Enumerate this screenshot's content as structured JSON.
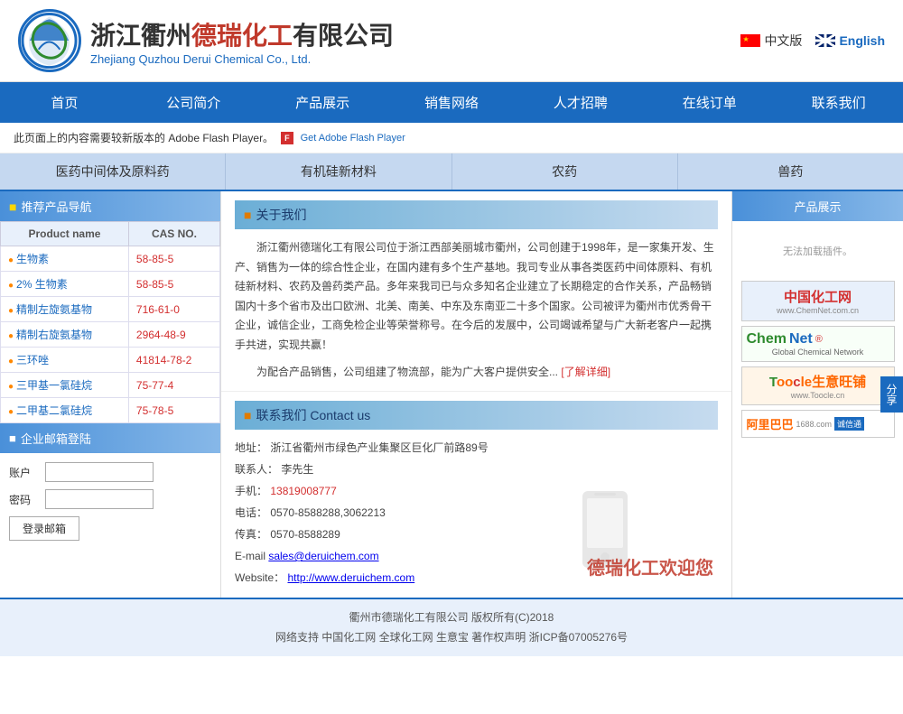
{
  "header": {
    "logo_cn_prefix": "浙江衢州",
    "logo_cn_brand": "德瑞化工",
    "logo_cn_suffix": "有限公司",
    "logo_en": "Zhejiang Quzhou Derui Chemical Co., Ltd.",
    "lang_cn": "中文版",
    "lang_en": "English"
  },
  "nav": {
    "items": [
      "首页",
      "公司简介",
      "产品展示",
      "销售网络",
      "人才招聘",
      "在线订单",
      "联系我们"
    ]
  },
  "flash_notice": "此页面上的内容需要较新版本的 Adobe Flash Player。",
  "flash_label": "Get Adobe Flash Player",
  "categories": [
    "医药中间体及原料药",
    "有机硅新材料",
    "农药",
    "兽药"
  ],
  "sidebar": {
    "rec_header": "推荐产品导航",
    "col_product": "Product name",
    "col_cas": "CAS NO.",
    "products": [
      {
        "name": "生物素",
        "cas": "58-85-5"
      },
      {
        "name": "2% 生物素",
        "cas": "58-85-5"
      },
      {
        "name": "精制左旋氨基物",
        "cas": "716-61-0"
      },
      {
        "name": "精制右旋氨基物",
        "cas": "2964-48-9"
      },
      {
        "name": "三环唑",
        "cas": "41814-78-2"
      },
      {
        "name": "三甲基一氯硅烷",
        "cas": "75-77-4"
      },
      {
        "name": "二甲基二氯硅烷",
        "cas": "75-78-5"
      }
    ],
    "mailbox_header": "企业邮箱登陆",
    "form_user_label": "账户",
    "form_pass_label": "密码",
    "login_btn": "登录邮箱"
  },
  "about": {
    "header": "关于我们",
    "text1": "浙江衢州德瑞化工有限公司位于浙江西部美丽城市衢州，公司创建于1998年，是一家集开发、生产、销售为一体的综合性企业，在国内建有多个生产基地。我司专业从事各类医药中间体原料、有机硅新材料、农药及兽药类产品。多年来我司已与众多知名企业建立了长期稳定的合作关系，产品畅销国内十多个省市及出口欧洲、北美、南美、中东及东南亚二十多个国家。公司被评为衢州市优秀骨干企业，诚信企业，工商免检企业等荣誉称号。在今后的发展中，公司竭诚希望与广大新老客户一起携手共进，实现共赢！",
    "text2": "为配合产品销售，公司组建了物流部，能为广大客户提供安全...",
    "detail_link": "[了解详细]"
  },
  "contact": {
    "header": "联系我们  Contact us",
    "address_label": "地址：",
    "address": "浙江省衢州市绿色产业集聚区巨化厂前路89号",
    "person_label": "联系人：",
    "person": "李先生",
    "mobile_label": "手机：",
    "mobile": "13819008777",
    "tel_label": "电话：",
    "tel": "0570-8588288,3062213",
    "fax_label": "传真：",
    "fax": "0570-8588289",
    "email_label": "E-mail  ",
    "email": "sales@deruichem.com",
    "website_label": "Website：",
    "website": "http://www.deruichem.com",
    "welcome": "德瑞化工欢迎您"
  },
  "right_sidebar": {
    "header": "产品展示",
    "cannot_load": "无法加载插件。",
    "partners": [
      {
        "key": "cn_chem",
        "name": "中国化工网",
        "sub": "www.ChemNet.com.cn"
      },
      {
        "key": "chemnet",
        "name": "ChemNet",
        "sub": "Global Chemical Network"
      },
      {
        "key": "toocle",
        "name": "Toocle生意旺铺",
        "sub": "www.Toocle.cn"
      },
      {
        "key": "ali",
        "name": "阿里巴巴",
        "sub": "1688.com",
        "badge": "诚信通"
      }
    ]
  },
  "side_tab": "分享",
  "footer": {
    "copyright": "衢州市德瑞化工有限公司 版权所有(C)2018",
    "support": "网络支持 中国化工网 全球化工网 生意宝 著作权声明 浙ICP备07005276号"
  }
}
